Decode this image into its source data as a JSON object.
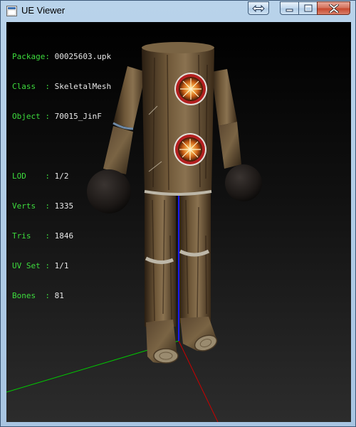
{
  "window": {
    "title": "UE Viewer"
  },
  "info": {
    "rows_top": [
      {
        "key": "Package",
        "sep": ": ",
        "value": "00025603.upk"
      },
      {
        "key": "Class  ",
        "sep": ": ",
        "value": "SkeletalMesh"
      },
      {
        "key": "Object ",
        "sep": ": ",
        "value": "70015_JinF"
      }
    ],
    "rows_bottom": [
      {
        "key": "LOD    ",
        "sep": ": ",
        "value": "1/2"
      },
      {
        "key": "Verts  ",
        "sep": ": ",
        "value": "1335"
      },
      {
        "key": "Tris   ",
        "sep": ": ",
        "value": "1846"
      },
      {
        "key": "UV Set ",
        "sep": ": ",
        "value": "1/1"
      },
      {
        "key": "Bones  ",
        "sep": ": ",
        "value": "81"
      }
    ]
  },
  "colors": {
    "info_key": "#3ddc3d",
    "info_value": "#e8e8e8",
    "axis_x": "#cc0000",
    "axis_y": "#00cc00",
    "axis_z": "#1a1aff",
    "close_button": "#c74a2f"
  },
  "icons": {
    "app": "ue-viewer-app-icon",
    "toggle": "double-arrow-icon",
    "minimize": "minimize-icon",
    "maximize": "maximize-icon",
    "close": "close-icon"
  }
}
